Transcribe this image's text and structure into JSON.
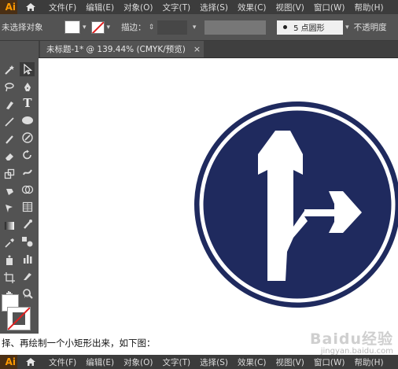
{
  "app": {
    "logo": "Ai"
  },
  "menu": [
    "文件(F)",
    "编辑(E)",
    "对象(O)",
    "文字(T)",
    "选择(S)",
    "效果(C)",
    "视图(V)",
    "窗口(W)",
    "帮助(H)"
  ],
  "control": {
    "selection_status": "未选择对象",
    "stroke_label": "描边：",
    "brush": "5 点圆形",
    "opacity_label": "不透明度"
  },
  "document": {
    "tab_title": "未标题-1* @ 139.44% (CMYK/预览)",
    "close_glyph": "×"
  },
  "caption": "择、再绘制一个小矩形出来，如下图：",
  "watermark": {
    "top": "Baidu经验",
    "bottom": "jingyan.baidu.com"
  },
  "colors": {
    "sign_blue": "#1f2a5e",
    "ui_dark": "#535353",
    "menubar": "#3c3c3c",
    "logo_orange": "#ff9a00"
  },
  "icons": [
    "home-icon",
    "direct-selection-icon",
    "pen-icon",
    "type-icon",
    "line-icon",
    "ellipse-icon",
    "brush-icon",
    "pencil-icon",
    "eraser-icon",
    "rotate-icon",
    "scale-icon",
    "warp-icon",
    "shape-builder-icon",
    "perspective-icon",
    "mesh-icon",
    "gradient-icon",
    "eyedropper-icon",
    "blend-icon",
    "symbol-icon",
    "graph-icon",
    "artboard-icon",
    "slice-icon",
    "hand-icon",
    "zoom-icon",
    "fill-stroke-icon",
    "swap-icon"
  ]
}
